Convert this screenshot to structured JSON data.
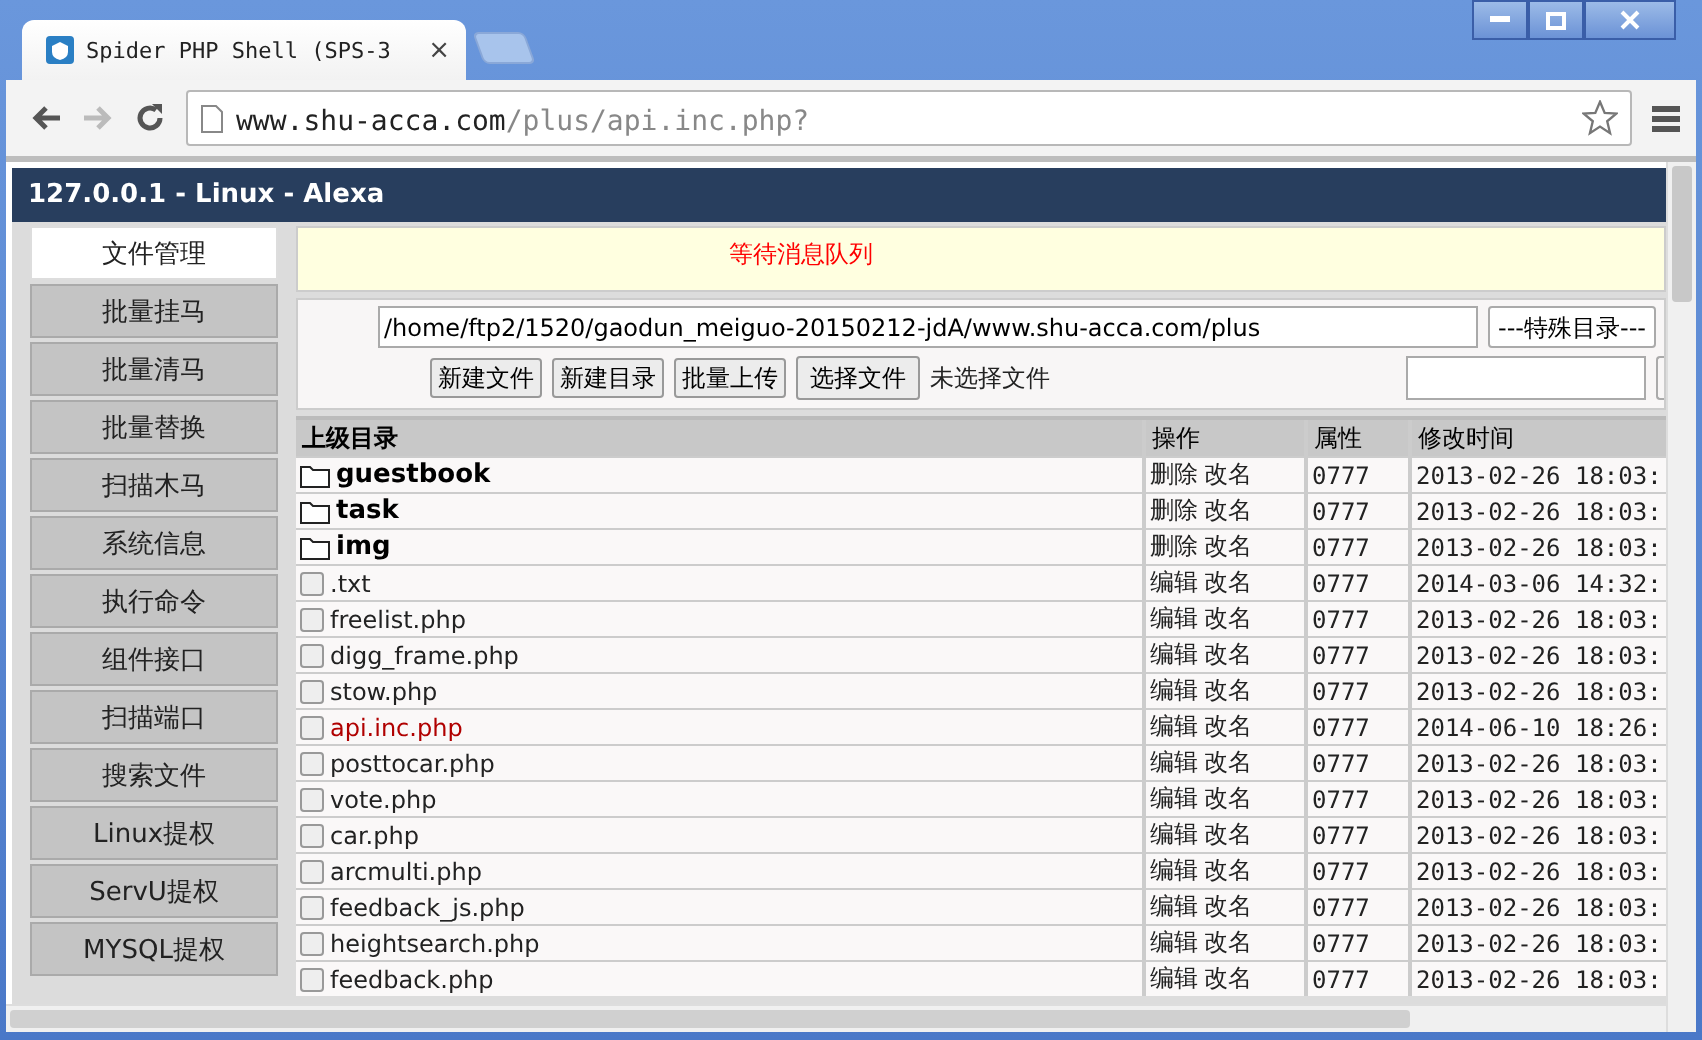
{
  "browser": {
    "tab_title": "Spider PHP Shell (SPS-3",
    "tab_close": "×",
    "url_host": "www.shu-acca.com",
    "url_path": "/plus/api.inc.php?"
  },
  "header": {
    "title": "127.0.0.1 - Linux - Alexa"
  },
  "sidebar": {
    "items": [
      {
        "label": "文件管理",
        "selected": true
      },
      {
        "label": "批量挂马",
        "selected": false
      },
      {
        "label": "批量清马",
        "selected": false
      },
      {
        "label": "批量替换",
        "selected": false
      },
      {
        "label": "扫描木马",
        "selected": false
      },
      {
        "label": "系统信息",
        "selected": false
      },
      {
        "label": "执行命令",
        "selected": false
      },
      {
        "label": "组件接口",
        "selected": false
      },
      {
        "label": "扫描端口",
        "selected": false
      },
      {
        "label": "搜索文件",
        "selected": false
      },
      {
        "label": "Linux提权",
        "selected": false
      },
      {
        "label": "ServU提权",
        "selected": false
      },
      {
        "label": "MYSQL提权",
        "selected": false
      }
    ]
  },
  "message": "等待消息队列",
  "path_bar": {
    "path": "/home/ftp2/1520/gaodun_meiguo-20150212-jdA/www.shu-acca.com/plus",
    "special_dir": "---特殊目录---",
    "buttons": [
      "新建文件",
      "新建目录",
      "批量上传"
    ],
    "file_button": "选择文件",
    "file_status": "未选择文件"
  },
  "table": {
    "columns": [
      "上级目录",
      "操作",
      "属性",
      "修改时间"
    ],
    "rows": [
      {
        "kind": "dir",
        "name": "guestbook",
        "actions": [
          "删除",
          "改名"
        ],
        "attr": "0777",
        "time": "2013-02-26 18:03:"
      },
      {
        "kind": "dir",
        "name": "task",
        "actions": [
          "删除",
          "改名"
        ],
        "attr": "0777",
        "time": "2013-02-26 18:03:"
      },
      {
        "kind": "dir",
        "name": "img",
        "actions": [
          "删除",
          "改名"
        ],
        "attr": "0777",
        "time": "2013-02-26 18:03:"
      },
      {
        "kind": "file",
        "name": ".txt",
        "actions": [
          "编辑",
          "改名"
        ],
        "attr": "0777",
        "time": "2014-03-06 14:32:",
        "checked": false,
        "current": false
      },
      {
        "kind": "file",
        "name": "freelist.php",
        "actions": [
          "编辑",
          "改名"
        ],
        "attr": "0777",
        "time": "2013-02-26 18:03:",
        "checked": false,
        "current": false
      },
      {
        "kind": "file",
        "name": "digg_frame.php",
        "actions": [
          "编辑",
          "改名"
        ],
        "attr": "0777",
        "time": "2013-02-26 18:03:",
        "checked": false,
        "current": false
      },
      {
        "kind": "file",
        "name": "stow.php",
        "actions": [
          "编辑",
          "改名"
        ],
        "attr": "0777",
        "time": "2013-02-26 18:03:",
        "checked": false,
        "current": false
      },
      {
        "kind": "file",
        "name": "api.inc.php",
        "actions": [
          "编辑",
          "改名"
        ],
        "attr": "0777",
        "time": "2014-06-10 18:26:",
        "checked": false,
        "current": true
      },
      {
        "kind": "file",
        "name": "posttocar.php",
        "actions": [
          "编辑",
          "改名"
        ],
        "attr": "0777",
        "time": "2013-02-26 18:03:",
        "checked": false,
        "current": false
      },
      {
        "kind": "file",
        "name": "vote.php",
        "actions": [
          "编辑",
          "改名"
        ],
        "attr": "0777",
        "time": "2013-02-26 18:03:",
        "checked": false,
        "current": false
      },
      {
        "kind": "file",
        "name": "car.php",
        "actions": [
          "编辑",
          "改名"
        ],
        "attr": "0777",
        "time": "2013-02-26 18:03:",
        "checked": false,
        "current": false
      },
      {
        "kind": "file",
        "name": "arcmulti.php",
        "actions": [
          "编辑",
          "改名"
        ],
        "attr": "0777",
        "time": "2013-02-26 18:03:",
        "checked": false,
        "current": false
      },
      {
        "kind": "file",
        "name": "feedback_js.php",
        "actions": [
          "编辑",
          "改名"
        ],
        "attr": "0777",
        "time": "2013-02-26 18:03:",
        "checked": false,
        "current": false
      },
      {
        "kind": "file",
        "name": "heightsearch.php",
        "actions": [
          "编辑",
          "改名"
        ],
        "attr": "0777",
        "time": "2013-02-26 18:03:",
        "checked": false,
        "current": false
      },
      {
        "kind": "file",
        "name": "feedback.php",
        "actions": [
          "编辑",
          "改名"
        ],
        "attr": "0777",
        "time": "2013-02-26 18:03:",
        "checked": false,
        "current": false
      }
    ]
  }
}
